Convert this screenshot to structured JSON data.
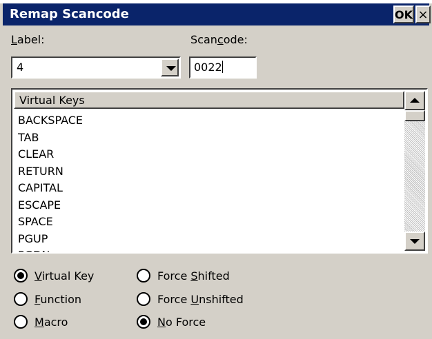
{
  "window": {
    "title": "Remap Scancode",
    "ok_label": "OK",
    "close_label": "×"
  },
  "label_field": {
    "label_prefix": "",
    "label_u": "L",
    "label_rest": "abel:",
    "value": "4"
  },
  "scancode_field": {
    "label_prefix": "Scan",
    "label_u": "c",
    "label_rest": "ode:",
    "value": "0022"
  },
  "virtual_keys": {
    "header": "Virtual Keys",
    "items": [
      "BACKSPACE",
      "TAB",
      "CLEAR",
      "RETURN",
      "CAPITAL",
      "ESCAPE",
      "SPACE",
      "PGUP",
      "PGDN"
    ]
  },
  "options": {
    "virtual_key": {
      "prefix": "",
      "u": "V",
      "rest": "irtual Key",
      "selected": true
    },
    "function": {
      "prefix": "",
      "u": "F",
      "rest": "unction",
      "selected": false
    },
    "macro": {
      "prefix": "",
      "u": "M",
      "rest": "acro",
      "selected": false
    },
    "force_shifted": {
      "prefix": "Force ",
      "u": "S",
      "rest": "hifted",
      "selected": false
    },
    "force_unshifted": {
      "prefix": "Force ",
      "u": "U",
      "rest": "nshifted",
      "selected": false
    },
    "no_force": {
      "prefix": "",
      "u": "N",
      "rest": "o Force",
      "selected": true
    }
  },
  "colors": {
    "titlebar": "#0a246a",
    "face": "#d4d0c8"
  }
}
